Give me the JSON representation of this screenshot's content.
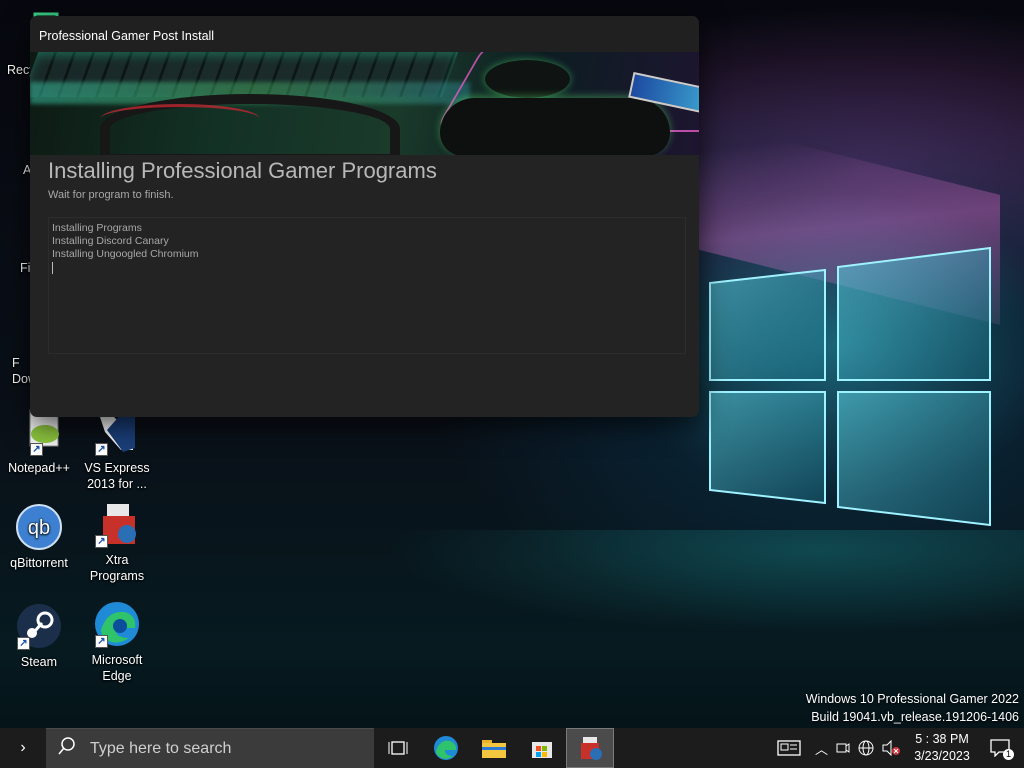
{
  "desktop_icons": [
    {
      "label": "Recy",
      "icon": "recycle-bin-icon"
    },
    {
      "label": "A",
      "icon": "app-icon"
    },
    {
      "label": "Fir",
      "icon": "firefox-icon"
    },
    {
      "label": "F\nDow",
      "icon": "downloads-icon"
    },
    {
      "label": "Notepad++",
      "icon": "notepadpp-icon"
    },
    {
      "label": "VS Express\n2013 for ...",
      "icon": "vs-express-icon"
    },
    {
      "label": "qBittorrent",
      "icon": "qbittorrent-icon"
    },
    {
      "label": "Xtra\nPrograms",
      "icon": "xtra-programs-icon"
    },
    {
      "label": "Steam",
      "icon": "steam-icon"
    },
    {
      "label": "Microsoft\nEdge",
      "icon": "edge-icon"
    }
  ],
  "installer": {
    "window_title": "Professional Gamer Post Install",
    "heading": "Installing Professional Gamer Programs",
    "subheading": "Wait for program to finish.",
    "log_lines": [
      "Installing Programs",
      "Installing Discord Canary",
      "Installing Ungoogled Chromium"
    ]
  },
  "watermark": {
    "line1": "Windows 10 Professional Gamer 2022",
    "line2": "Build 19041.vb_release.191206-1406"
  },
  "taskbar": {
    "search_placeholder": "Type here to search",
    "time": "5 : 38 PM",
    "date": "3/23/2023",
    "notification_count": "1"
  },
  "colors": {
    "window_bg": "#232323",
    "taskbar_bg": "#1c1c1c",
    "edge_blue": "#1f8ad6",
    "qbit_blue": "#3d7fd0"
  }
}
